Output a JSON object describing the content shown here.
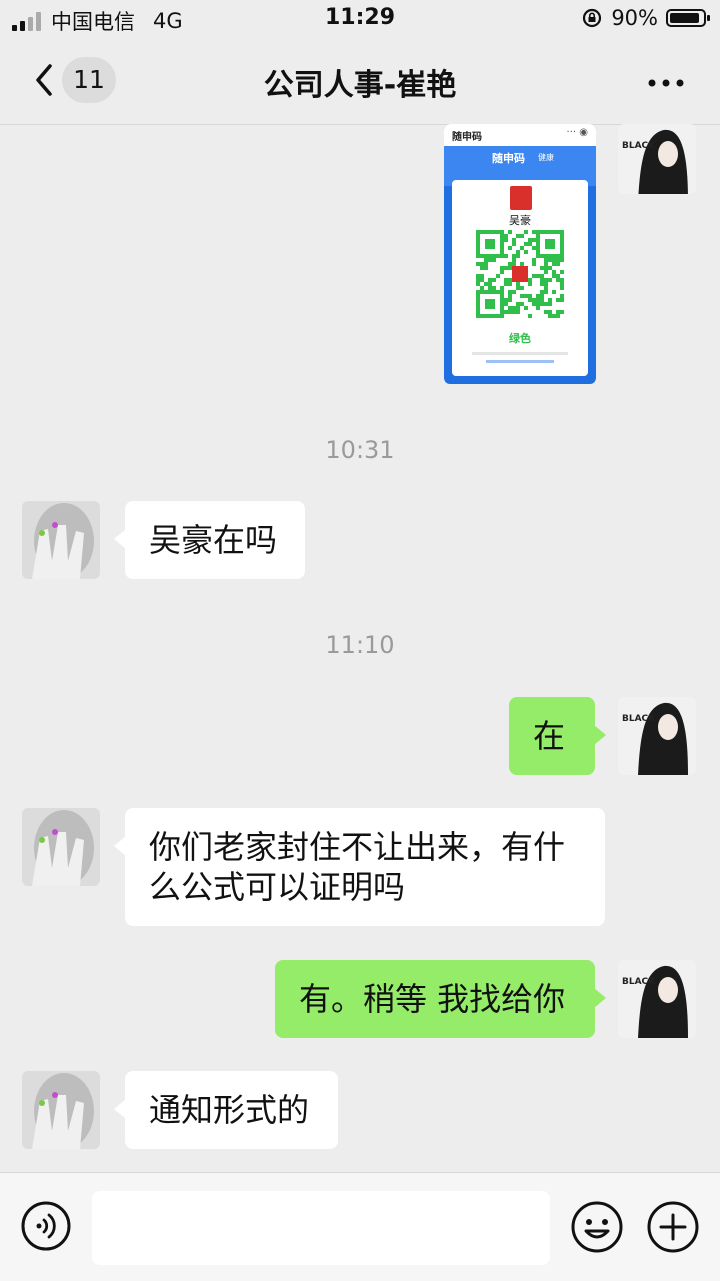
{
  "status": {
    "carrier": "中国电信",
    "network": "4G",
    "time": "11:29",
    "battery": "90%",
    "battery_level": 0.9
  },
  "nav": {
    "back_icon": "chevron-left-icon",
    "unread_count": "11",
    "title": "公司人事-崔艳",
    "more_icon": "more-icon"
  },
  "health_code": {
    "app_name": "随申码",
    "tag": "健康",
    "person_name": "吴豪",
    "status": "绿色",
    "status_color": "#2fbf4a"
  },
  "messages": {
    "ts1": "10:31",
    "m1": "吴豪在吗",
    "ts2": "11:10",
    "m2": "在",
    "m3": "你们老家封住不让出来，有什么公式可以证明吗",
    "m4": "有。稍等 我找给你",
    "m5": "通知形式的"
  },
  "input": {
    "placeholder": "",
    "voice_icon": "voice-icon",
    "emoji_icon": "emoji-icon",
    "plus_icon": "plus-icon"
  },
  "colors": {
    "out_bubble": "#95ec69",
    "in_bubble": "#ffffff",
    "background": "#ededed"
  }
}
